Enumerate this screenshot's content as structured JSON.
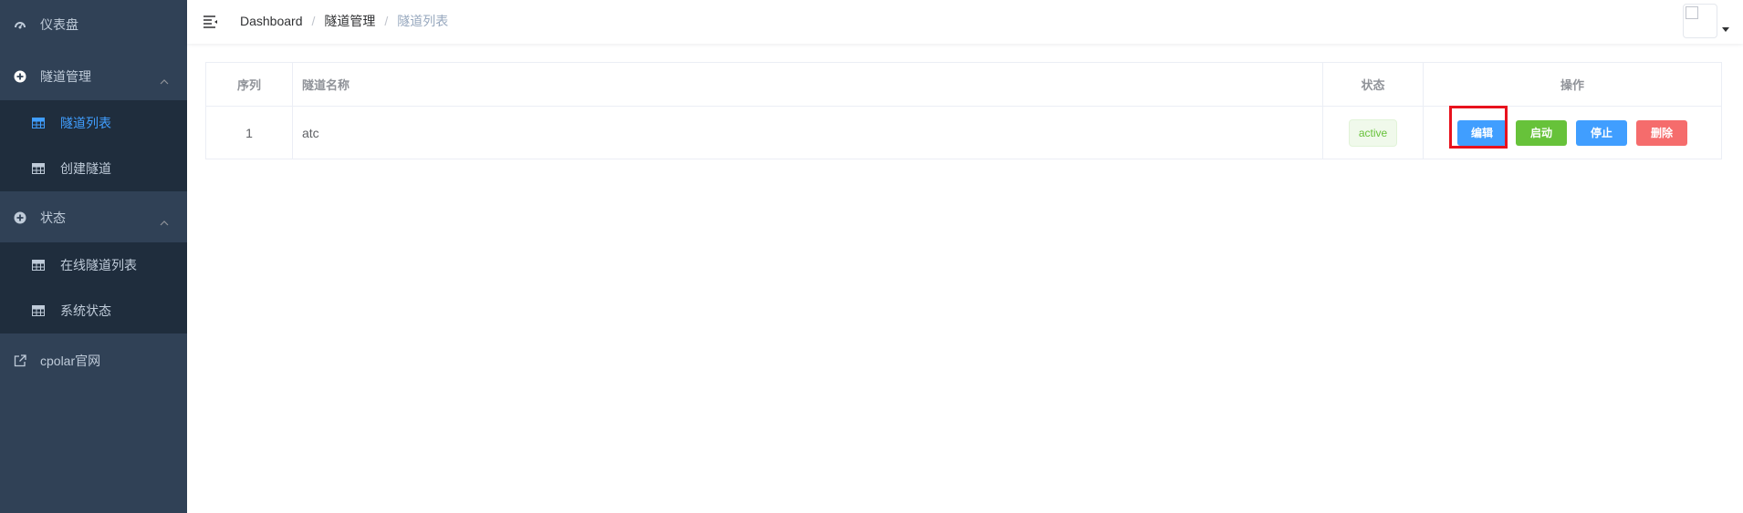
{
  "sidebar": {
    "items": [
      {
        "label": "仪表盘",
        "icon": "dashboard-icon"
      },
      {
        "label": "隧道管理",
        "icon": "plus-circle-icon"
      },
      {
        "label": "隧道列表",
        "icon": "grid-icon",
        "active": true
      },
      {
        "label": "创建隧道",
        "icon": "grid-icon"
      },
      {
        "label": "状态",
        "icon": "plus-circle-icon"
      },
      {
        "label": "在线隧道列表",
        "icon": "grid-icon"
      },
      {
        "label": "系统状态",
        "icon": "grid-icon"
      },
      {
        "label": "cpolar官网",
        "icon": "external-link-icon"
      }
    ]
  },
  "breadcrumb": {
    "items": [
      "Dashboard",
      "隧道管理"
    ],
    "current": "隧道列表",
    "separator": "/"
  },
  "table": {
    "headers": {
      "index": "序列",
      "name": "隧道名称",
      "status": "状态",
      "actions": "操作"
    },
    "rows": [
      {
        "index": "1",
        "name": "atc",
        "status": "active"
      }
    ],
    "buttons": {
      "edit": "编辑",
      "start": "启动",
      "stop": "停止",
      "delete": "删除"
    }
  },
  "colors": {
    "sidebar_bg": "#304156",
    "submenu_bg": "#1f2d3d",
    "active": "#409eff",
    "success": "#67c23a",
    "danger": "#f56c6c",
    "highlight": "#e8121d"
  }
}
